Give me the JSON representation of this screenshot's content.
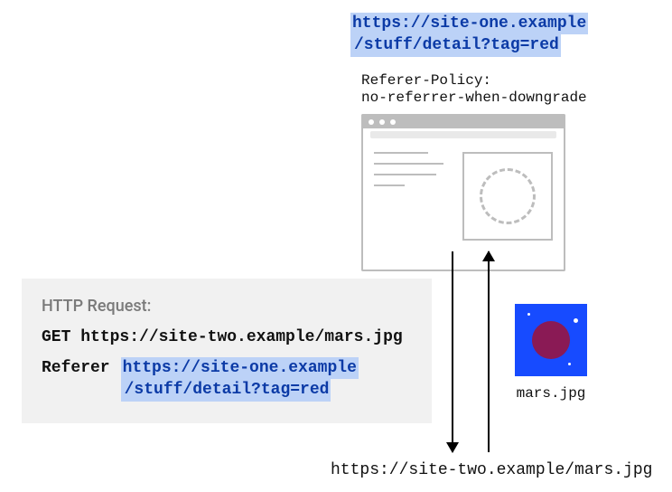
{
  "top": {
    "url_line1": "https://site-one.example",
    "url_line2": "/stuff/detail?tag=red"
  },
  "policy": {
    "header": "Referer-Policy:",
    "value": "no-referrer-when-downgrade"
  },
  "request": {
    "title": "HTTP Request:",
    "method": "GET",
    "url": "https://site-two.example/mars.jpg",
    "referer_label": "Referer",
    "referer_line1": "https://site-one.example",
    "referer_line2": "/stuff/detail?tag=red"
  },
  "mars": {
    "filename": "mars.jpg"
  },
  "destination_url": "https://site-two.example/mars.jpg"
}
